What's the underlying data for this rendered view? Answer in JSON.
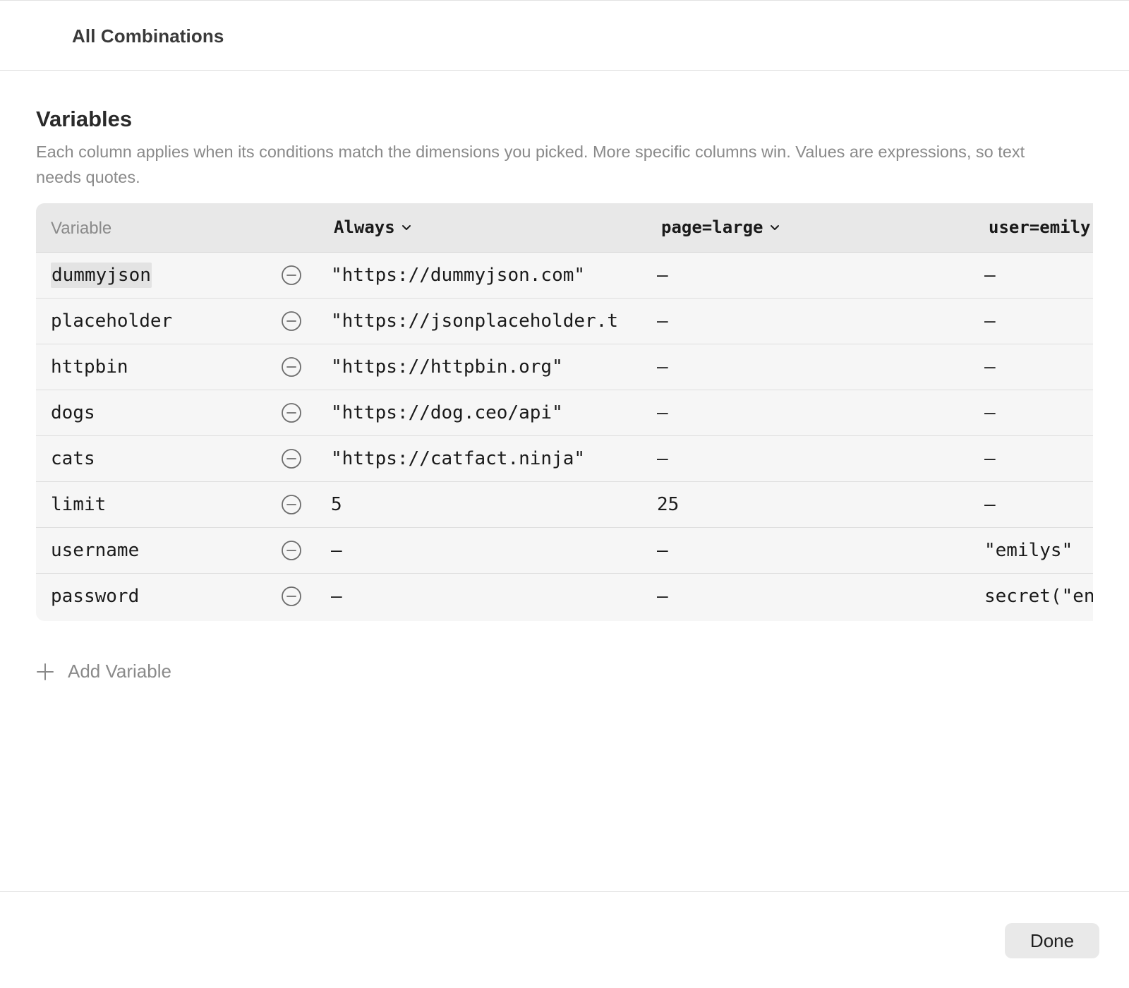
{
  "header": {
    "title": "All Combinations"
  },
  "section": {
    "title": "Variables",
    "description": "Each column applies when its conditions match the dimensions you picked. More specific columns win. Values are expressions, so text needs quotes."
  },
  "table": {
    "variable_header": "Variable",
    "columns": [
      {
        "label": "Always"
      },
      {
        "label": "page=large"
      },
      {
        "label": "user=emily"
      }
    ],
    "rows": [
      {
        "name": "dummyjson",
        "values": [
          "\"https://dummyjson.com\"",
          "—",
          "—"
        ]
      },
      {
        "name": "placeholder",
        "values": [
          "\"https://jsonplaceholder.t",
          "—",
          "—"
        ]
      },
      {
        "name": "httpbin",
        "values": [
          "\"https://httpbin.org\"",
          "—",
          "—"
        ]
      },
      {
        "name": "dogs",
        "values": [
          "\"https://dog.ceo/api\"",
          "—",
          "—"
        ]
      },
      {
        "name": "cats",
        "values": [
          "\"https://catfact.ninja\"",
          "—",
          "—"
        ]
      },
      {
        "name": "limit",
        "values": [
          "5",
          "25",
          "—"
        ]
      },
      {
        "name": "username",
        "values": [
          "—",
          "—",
          "\"emilys\""
        ]
      },
      {
        "name": "password",
        "values": [
          "—",
          "—",
          "secret(\"en"
        ]
      }
    ]
  },
  "add_variable": {
    "label": "Add Variable"
  },
  "footer": {
    "done_label": "Done"
  }
}
